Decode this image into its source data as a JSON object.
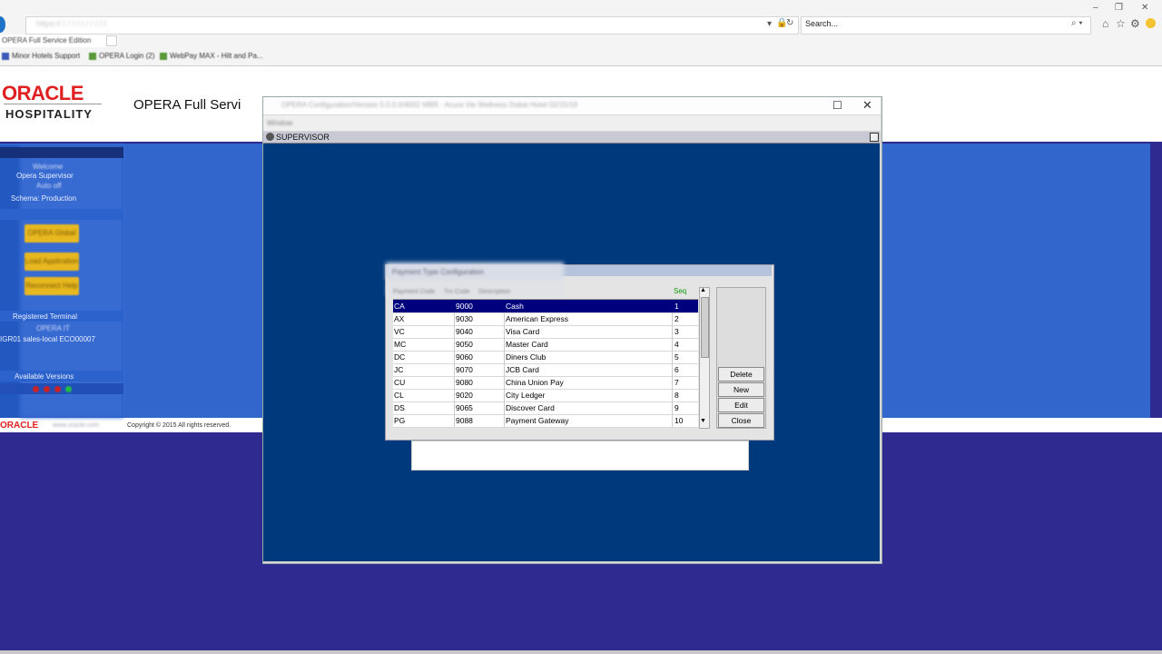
{
  "browser": {
    "address": "https://  /  /  /  /  /  /  /  /  /  /",
    "search_placeholder": "Search...",
    "tab_title": "OPERA Full Service Edition",
    "favorites": [
      "Minor Hotels Support",
      "OPERA Login (2)",
      "WebPay MAX - Hilt and Pa..."
    ],
    "window_min": "–",
    "window_restore": "❐",
    "window_close": "✕"
  },
  "opera": {
    "logo_top": "ORACLE",
    "logo_bottom": "HOSPITALITY",
    "title": "OPERA Full Servi",
    "footer_logo": "ORACLE",
    "footer_link": "www.oracle.com",
    "copyright": "Copyright © 2015 All rights reserved."
  },
  "sidebar": {
    "welcome_lines": [
      "Welcome",
      "Opera Supervisor",
      "Auto off",
      "Schema: Production"
    ],
    "button_labels": [
      "OPERA Global",
      "Load Application",
      "Reconnect Help"
    ],
    "registered_label": "Registered Terminal",
    "terminal_lines": [
      "OPERA IT",
      "IGR01 sales-local ECO00007"
    ],
    "available_label": "Available Versions",
    "dot_colors": [
      "#cc2222",
      "#cc2222",
      "#cc2222",
      "#22bb44"
    ]
  },
  "window": {
    "title": "OPERA Configuration/Version 5.0.0.0/4002     MBR - Acura Vie Wellness Dubai Hotel     02/15/19",
    "menu": "Window",
    "maximize_glyph": "☐",
    "close_glyph": "✕",
    "mdi_title": "SUPERVISOR"
  },
  "dialog": {
    "title": "Payment Type Configuration",
    "columns_blurred": [
      "Payment Code",
      "Trx Code",
      "Description"
    ],
    "seq_header": "Seq",
    "rows": [
      {
        "code": "CA",
        "trx": "9000",
        "desc": "Cash",
        "seq": "1"
      },
      {
        "code": "AX",
        "trx": "9030",
        "desc": "American Express",
        "seq": "2"
      },
      {
        "code": "VC",
        "trx": "9040",
        "desc": "Visa Card",
        "seq": "3"
      },
      {
        "code": "MC",
        "trx": "9050",
        "desc": "Master Card",
        "seq": "4"
      },
      {
        "code": "DC",
        "trx": "9060",
        "desc": "Diners Club",
        "seq": "5"
      },
      {
        "code": "JC",
        "trx": "9070",
        "desc": "JCB Card",
        "seq": "6"
      },
      {
        "code": "CU",
        "trx": "9080",
        "desc": "China Union Pay",
        "seq": "7"
      },
      {
        "code": "CL",
        "trx": "9020",
        "desc": "City Ledger",
        "seq": "8"
      },
      {
        "code": "DS",
        "trx": "9065",
        "desc": "Discover Card",
        "seq": "9"
      },
      {
        "code": "PG",
        "trx": "9088",
        "desc": "Payment Gateway",
        "seq": "10"
      }
    ],
    "buttons": {
      "delete": "Delete",
      "new": "New",
      "edit": "Edit",
      "close": "Close"
    },
    "scroll_up": "▲",
    "scroll_down": "▼"
  }
}
